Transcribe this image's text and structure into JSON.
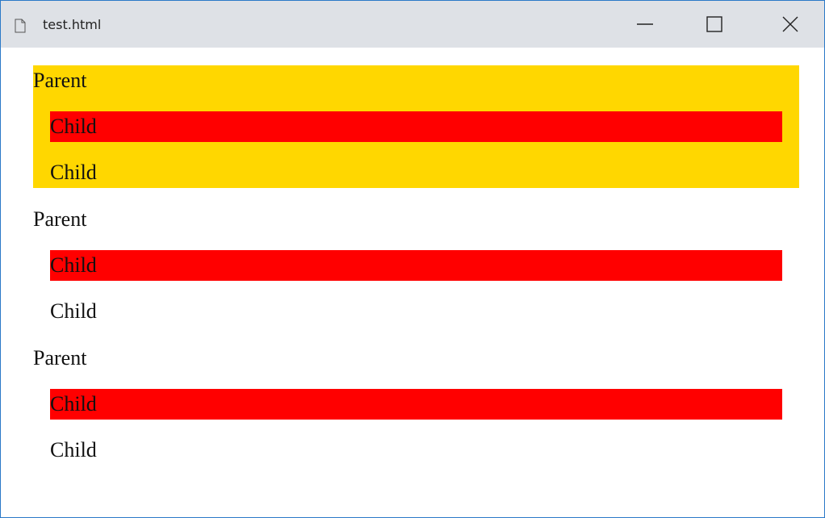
{
  "window": {
    "title": "test.html",
    "icons": {
      "file": "file-icon",
      "minimize": "minimize-icon",
      "maximize": "maximize-icon",
      "close": "close-icon"
    }
  },
  "content": {
    "parents": [
      {
        "label": "Parent",
        "highlight_color": "#ffd700",
        "children": [
          {
            "label": "Child",
            "background": "#ff0000"
          },
          {
            "label": "Child",
            "background": "transparent"
          }
        ]
      },
      {
        "label": "Parent",
        "highlight_color": "transparent",
        "children": [
          {
            "label": "Child",
            "background": "#ff0000"
          },
          {
            "label": "Child",
            "background": "transparent"
          }
        ]
      },
      {
        "label": "Parent",
        "highlight_color": "transparent",
        "children": [
          {
            "label": "Child",
            "background": "#ff0000"
          },
          {
            "label": "Child",
            "background": "transparent"
          }
        ]
      }
    ]
  }
}
